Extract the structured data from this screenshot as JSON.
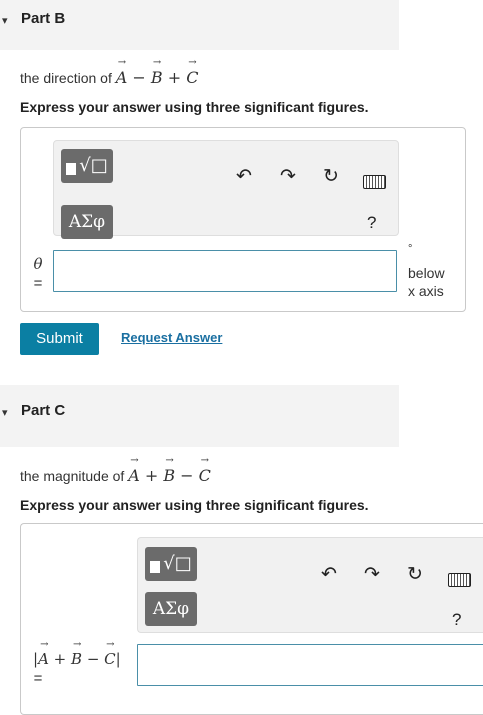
{
  "partB": {
    "caret": "▾",
    "title": "Part B",
    "prompt_text": "the direction of ",
    "instruction": "Express your answer using three significant figures.",
    "toolbar": {
      "greek_label": "AΣφ",
      "help_label": "?"
    },
    "var_symbol": "θ",
    "equals": "=",
    "degree_symbol": "°",
    "unit_line1": "below",
    "unit_line2": "x axis",
    "input_value": ""
  },
  "actions": {
    "submit_label": "Submit",
    "request_label": "Request Answer"
  },
  "partC": {
    "caret": "▾",
    "title": "Part C",
    "prompt_text": "the magnitude of ",
    "instruction": "Express your answer using three significant figures.",
    "toolbar": {
      "greek_label": "AΣφ",
      "help_label": "?"
    },
    "equals": "=",
    "input_value": ""
  },
  "icons": [
    "templates-icon",
    "undo-icon",
    "redo-icon",
    "reset-icon",
    "keyboard-icon"
  ],
  "colors": {
    "header_bg": "#f3f3f3",
    "submit_bg": "#0b7fa3",
    "link": "#1a6fa1",
    "toolbar_button": "#6b6b6b"
  }
}
